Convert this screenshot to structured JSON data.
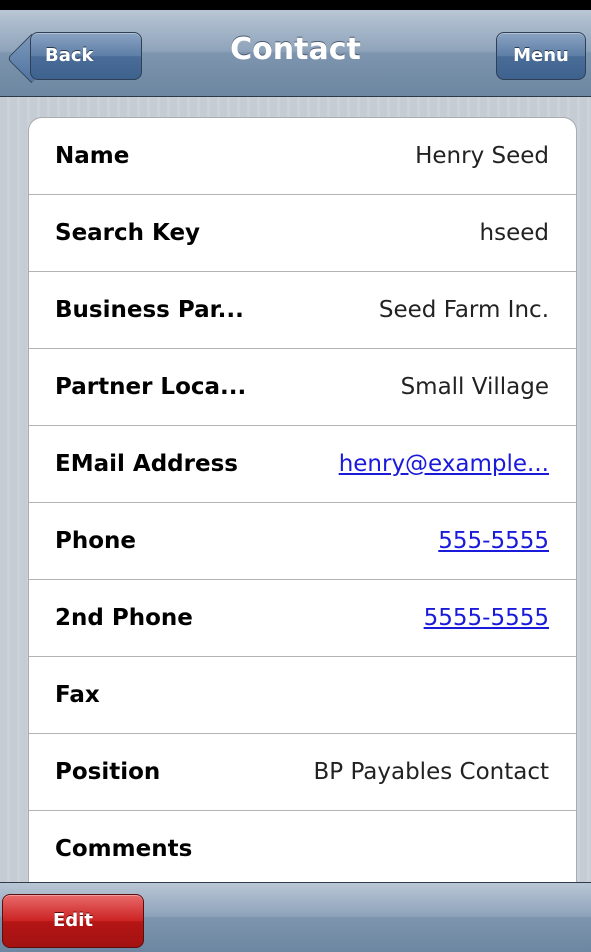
{
  "nav": {
    "title": "Contact",
    "back_label": "Back",
    "menu_label": "Menu"
  },
  "fields": [
    {
      "label": "Name",
      "value": "Henry Seed",
      "link": false
    },
    {
      "label": "Search Key",
      "value": "hseed",
      "link": false
    },
    {
      "label": "Business Par...",
      "value": "Seed Farm Inc.",
      "link": false
    },
    {
      "label": "Partner Loca...",
      "value": "Small Village",
      "link": false
    },
    {
      "label": "EMail Address",
      "value": "henry@example...",
      "link": true
    },
    {
      "label": "Phone",
      "value": "555-5555",
      "link": true
    },
    {
      "label": "2nd Phone",
      "value": "5555-5555",
      "link": true
    },
    {
      "label": "Fax",
      "value": "",
      "link": false
    },
    {
      "label": "Position",
      "value": "BP Payables Contact",
      "link": false
    },
    {
      "label": "Comments",
      "value": "",
      "link": false
    }
  ],
  "toolbar": {
    "edit_label": "Edit"
  },
  "colors": {
    "link": "#1a1adb",
    "edit_button": "#cc2222",
    "nav_bar": "#7d95ae"
  }
}
